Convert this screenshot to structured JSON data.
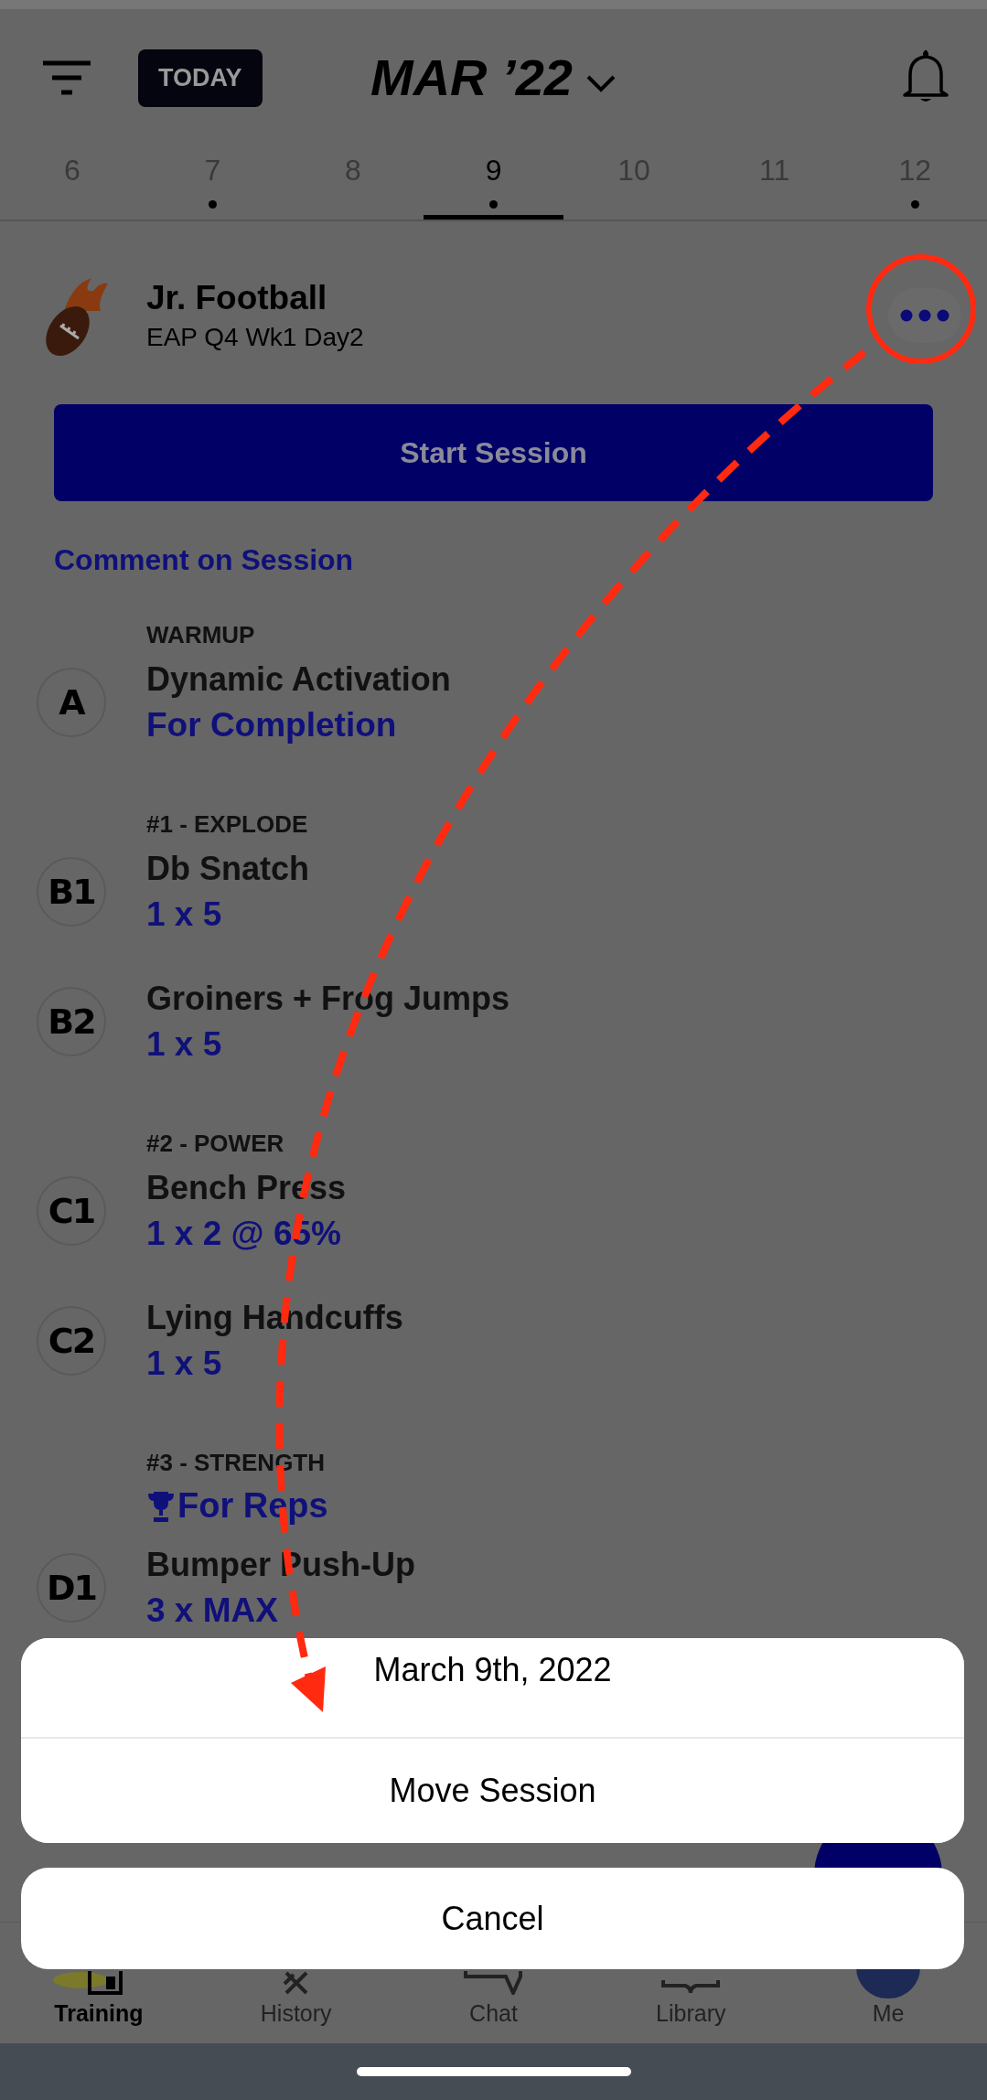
{
  "header": {
    "today_button": "TODAY",
    "title": "MAR ’22"
  },
  "dates": [
    {
      "label": "6",
      "selected": false,
      "has_session": false
    },
    {
      "label": "7",
      "selected": false,
      "has_session": true
    },
    {
      "label": "8",
      "selected": false,
      "has_session": false
    },
    {
      "label": "9",
      "selected": true,
      "has_session": true
    },
    {
      "label": "10",
      "selected": false,
      "has_session": false
    },
    {
      "label": "11",
      "selected": false,
      "has_session": false
    },
    {
      "label": "12",
      "selected": false,
      "has_session": true
    }
  ],
  "session": {
    "title": "Jr. Football",
    "subtitle": "EAP Q4 Wk1 Day2",
    "start_button": "Start Session",
    "comment_link": "Comment on Session"
  },
  "groups": [
    {
      "heading": "WARMUP",
      "exercises": [
        {
          "badge": "A",
          "name": "Dynamic Activation",
          "prescription": "For Completion"
        }
      ]
    },
    {
      "heading": "#1 - EXPLODE",
      "exercises": [
        {
          "badge": "B1",
          "name": "Db Snatch",
          "prescription": "1 x 5"
        },
        {
          "badge": "B2",
          "name": "Groiners + Frog Jumps",
          "prescription": "1 x 5"
        }
      ]
    },
    {
      "heading": "#2 - POWER",
      "exercises": [
        {
          "badge": "C1",
          "name": "Bench Press",
          "prescription": "1 x 2 @ 65%"
        },
        {
          "badge": "C2",
          "name": "Lying Handcuffs",
          "prescription": "1 x 5"
        }
      ]
    },
    {
      "heading": "#3 - STRENGTH",
      "note": "For Reps",
      "exercises": [
        {
          "badge": "D1",
          "name": "Bumper Push-Up",
          "prescription": "3 x MAX"
        }
      ]
    }
  ],
  "action_sheet": {
    "options": [
      "March 9th, 2022",
      "Move Session"
    ],
    "cancel": "Cancel"
  },
  "tab_bar": [
    {
      "label": "Training",
      "selected": true
    },
    {
      "label": "History",
      "selected": false
    },
    {
      "label": "Chat",
      "selected": false
    },
    {
      "label": "Library",
      "selected": false
    },
    {
      "label": "Me",
      "selected": false
    }
  ]
}
